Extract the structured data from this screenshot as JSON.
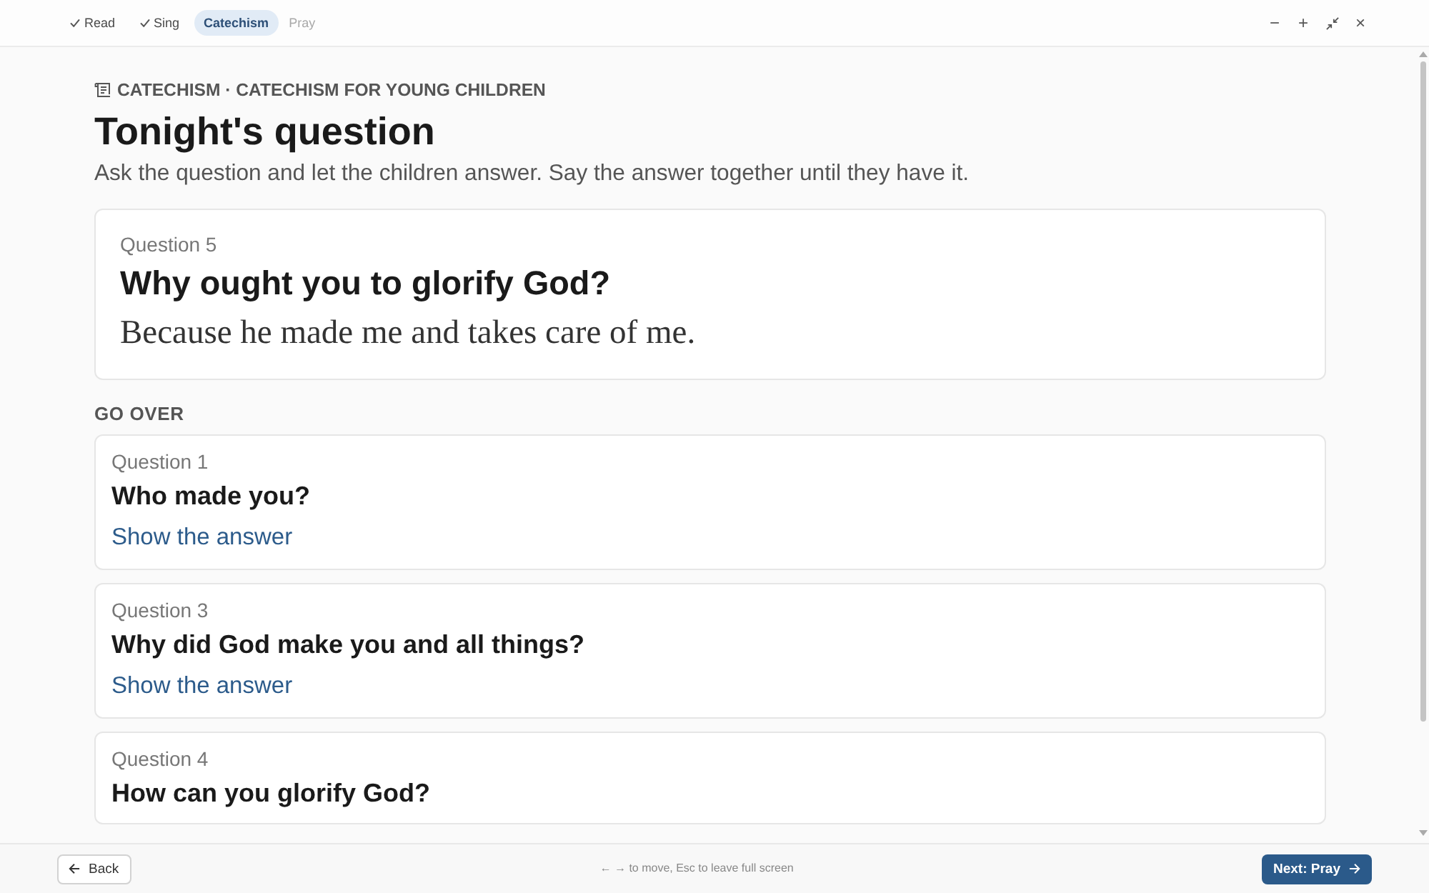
{
  "steps": [
    {
      "label": "Read",
      "done": true,
      "selected": false
    },
    {
      "label": "Sing",
      "done": true,
      "selected": false
    },
    {
      "label": "Catechism",
      "done": false,
      "selected": true
    },
    {
      "label": "Pray",
      "done": false,
      "selected": false
    }
  ],
  "window_controls": [
    {
      "kind": "minus",
      "label": "−"
    },
    {
      "kind": "plus",
      "label": "+"
    },
    {
      "kind": "collapse"
    },
    {
      "kind": "close",
      "label": "×"
    }
  ],
  "header": {
    "eyebrow": "CATECHISM · CATECHISM FOR YOUNG CHILDREN",
    "title": "Tonight's question",
    "intro": "Ask the question and let the children answer. Say the answer together until they have it."
  },
  "current": {
    "number": "Question 5",
    "question": "Why ought you to glorify God?",
    "answer": "Because he made me and takes care of me."
  },
  "review": {
    "heading": "GO OVER",
    "items": [
      {
        "number": "Question 1",
        "question": "Who made you?",
        "link": "Show the answer"
      },
      {
        "number": "Question 3",
        "question": "Why did God make you and all things?",
        "link": "Show the answer"
      },
      {
        "number": "Question 4",
        "question": "How can you glorify God?"
      }
    ]
  },
  "footer": {
    "back": "Back",
    "hint": "← → to move, Esc to leave full screen",
    "next": "Next: Pray"
  }
}
